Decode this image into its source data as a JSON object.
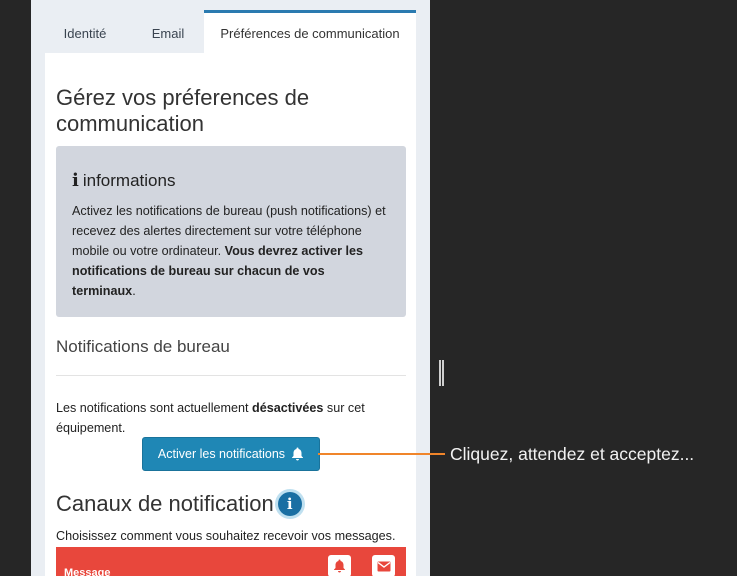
{
  "tabs": [
    {
      "label": "Identité"
    },
    {
      "label": "Email"
    },
    {
      "label": "Préférences de communication"
    }
  ],
  "page_title": "Gérez vos préferences de communication",
  "info_box": {
    "title": "informations",
    "text_plain": "Activez les notifications de bureau (push notifications) et recevez des alertes directement sur votre téléphone mobile ou votre ordinateur. ",
    "text_bold": "Vous devrez activer les notifications de bureau sur chacun de vos terminaux",
    "text_end": "."
  },
  "desktop_notifications": {
    "title": "Notifications de bureau",
    "status_prefix": "Les notifications sont actuellement ",
    "status_bold": "désactivées",
    "status_suffix": " sur cet équipement.",
    "button_label": "Activer les notifications"
  },
  "channels": {
    "title": "Canaux de notification",
    "description": "Choisissez comment vous souhaitez recevoir vos messages.",
    "row_label": "Message"
  },
  "callout": {
    "text": "Cliquez, attendez et acceptez..."
  },
  "colors": {
    "accent": "#1f87b5",
    "message_bar": "#e8473c",
    "callout_line": "#f0852a"
  }
}
